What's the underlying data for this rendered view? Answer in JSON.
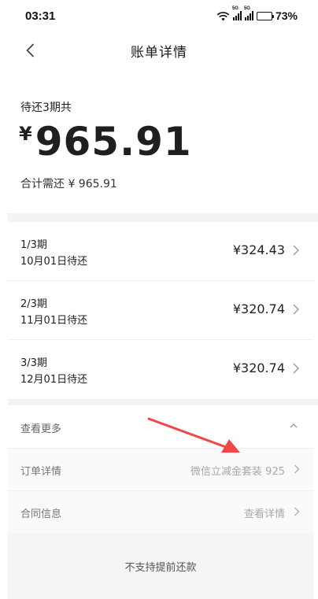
{
  "status_bar": {
    "time": "03:31",
    "battery": "73%",
    "icons": [
      "wifi-icon",
      "signal-5g-icon",
      "signal-5g-icon",
      "battery-charging-icon"
    ],
    "network_tags": [
      "5G",
      "5G"
    ],
    "battery_level": 0.73
  },
  "nav": {
    "title": "账单详情",
    "back_icon": "chevron-left-icon"
  },
  "summary": {
    "label": "待还3期共",
    "currency": "¥",
    "amount": "965.91",
    "total_text": "合计需还 ¥ 965.91"
  },
  "installments": [
    {
      "period": "1/3期",
      "date": "10月01日待还",
      "amount": "¥324.43"
    },
    {
      "period": "2/3期",
      "date": "11月01日待还",
      "amount": "¥320.74"
    },
    {
      "period": "3/3期",
      "date": "12月01日待还",
      "amount": "¥320.74"
    }
  ],
  "more": {
    "label": "查看更多",
    "toggle_icon": "chevron-up-icon",
    "rows": [
      {
        "label": "订单详情",
        "value": "微信立减金套装 925"
      },
      {
        "label": "合同信息",
        "value": "查看详情"
      }
    ]
  },
  "notice": {
    "text": "不支持提前还款"
  },
  "colors": {
    "annotation_arrow": "#f04848",
    "battery_fill": "#2dbe4a",
    "divider": "#f3f3f3"
  }
}
